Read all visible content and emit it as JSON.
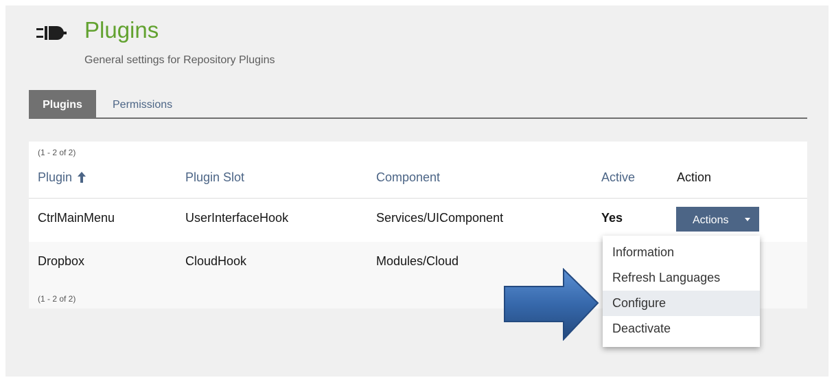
{
  "header": {
    "title": "Plugins",
    "subtitle": "General settings for Repository Plugins"
  },
  "tabs": [
    {
      "label": "Plugins",
      "active": true
    },
    {
      "label": "Permissions",
      "active": false
    }
  ],
  "table": {
    "range_top": "(1 - 2 of 2)",
    "range_bottom": "(1 - 2 of 2)",
    "columns": [
      "Plugin",
      "Plugin Slot",
      "Component",
      "Active",
      "Action"
    ],
    "sort_icon": "arrow-up-icon",
    "rows": [
      {
        "plugin": "CtrlMainMenu",
        "slot": "UserInterfaceHook",
        "component": "Services/UIComponent",
        "active": "Yes",
        "action": "Actions"
      },
      {
        "plugin": "Dropbox",
        "slot": "CloudHook",
        "component": "Modules/Cloud",
        "active": "",
        "action": ""
      }
    ]
  },
  "dropdown": {
    "items": [
      {
        "label": "Information"
      },
      {
        "label": "Refresh Languages"
      },
      {
        "label": "Configure",
        "highlighted": true
      },
      {
        "label": "Deactivate"
      }
    ]
  },
  "colors": {
    "title_green": "#62a230",
    "link_blue": "#4c6586",
    "tab_active_bg": "#717171",
    "arrow_blue": "#2f5e9e"
  },
  "icons": {
    "header": "plug-icon",
    "pointer": "right-arrow-icon"
  }
}
